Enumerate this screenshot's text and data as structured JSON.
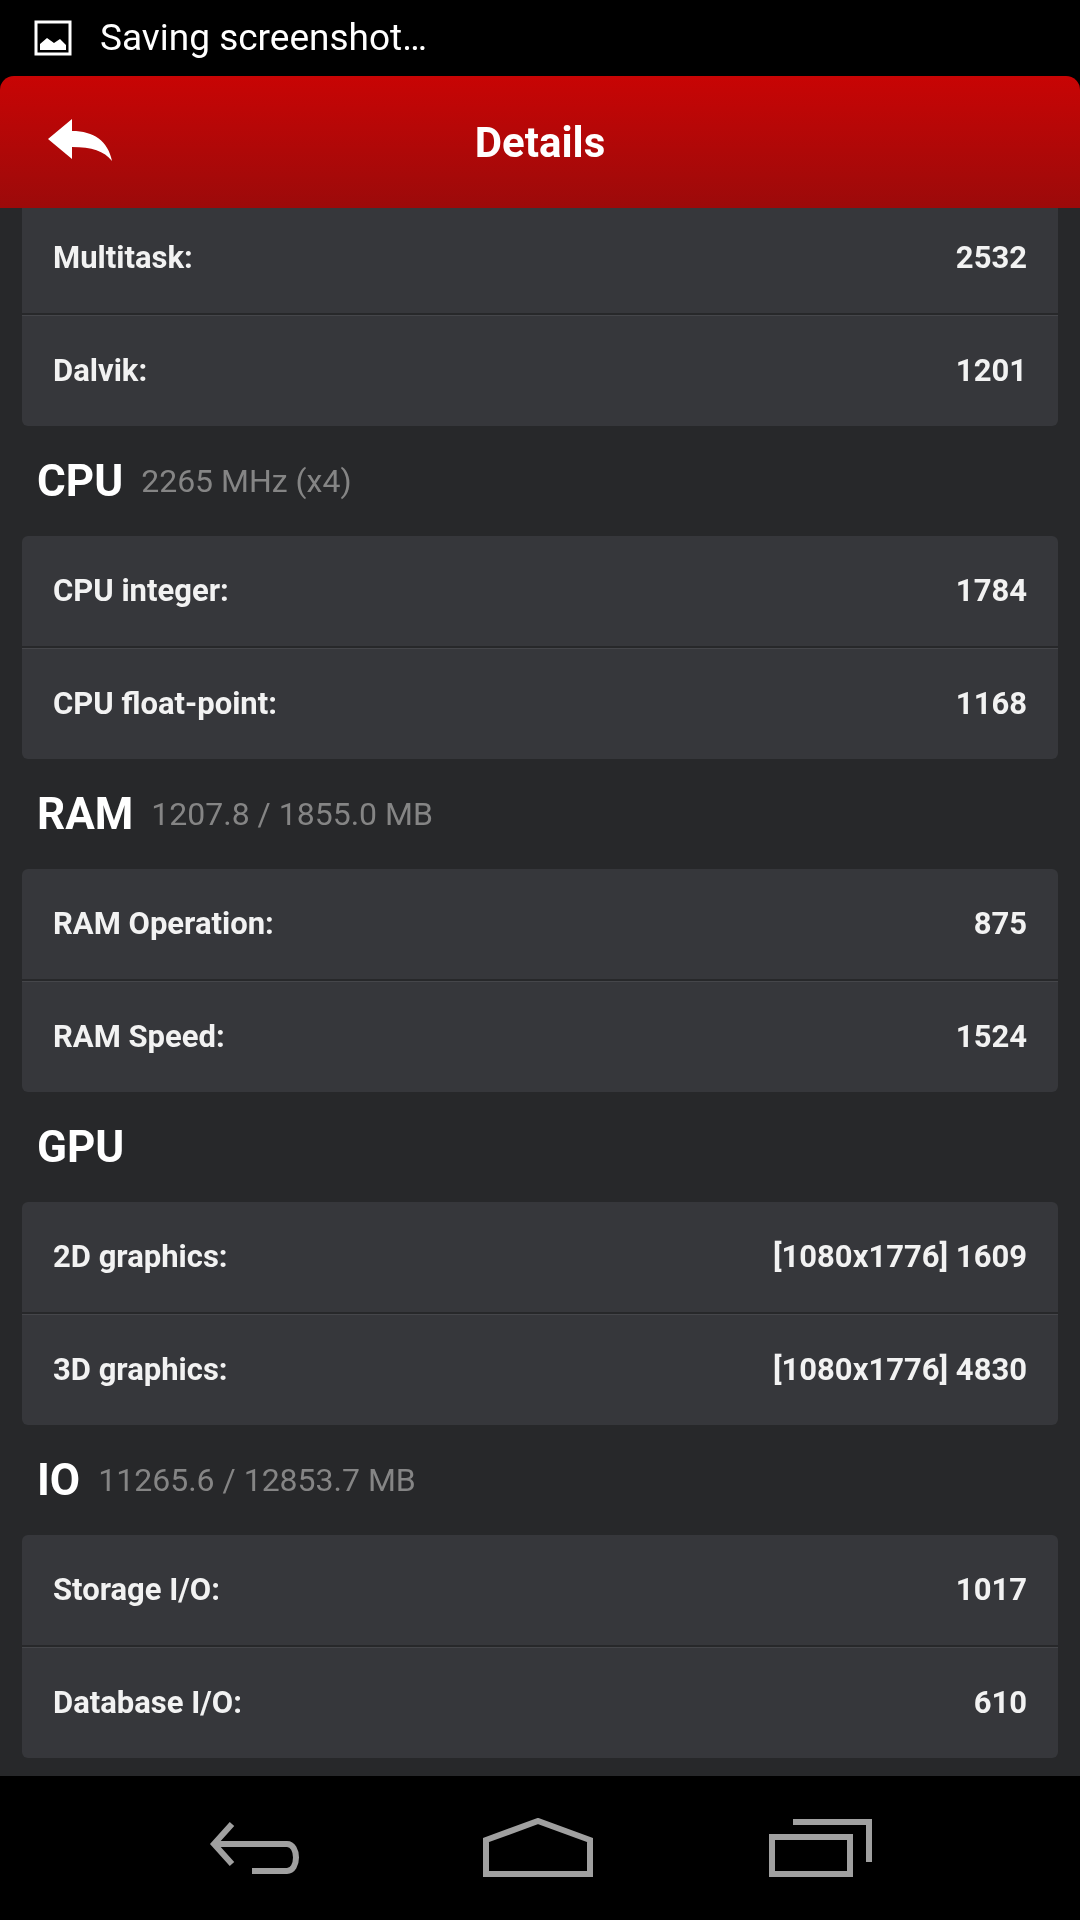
{
  "status_bar": {
    "notification": "Saving screenshot…"
  },
  "header": {
    "title": "Details"
  },
  "sections": [
    {
      "rows": [
        {
          "label": "Multitask:",
          "value": "2532"
        },
        {
          "label": "Dalvik:",
          "value": "1201"
        }
      ]
    },
    {
      "title": "CPU",
      "subtitle": "2265 MHz (x4)",
      "rows": [
        {
          "label": "CPU integer:",
          "value": "1784"
        },
        {
          "label": "CPU float-point:",
          "value": "1168"
        }
      ]
    },
    {
      "title": "RAM",
      "subtitle": "1207.8 / 1855.0 MB",
      "rows": [
        {
          "label": "RAM Operation:",
          "value": "875"
        },
        {
          "label": "RAM Speed:",
          "value": "1524"
        }
      ]
    },
    {
      "title": "GPU",
      "rows": [
        {
          "label": "2D graphics:",
          "value": "[1080x1776] 1609"
        },
        {
          "label": "3D graphics:",
          "value": "[1080x1776] 4830"
        }
      ]
    },
    {
      "title": "IO",
      "subtitle": "11265.6 / 12853.7 MB",
      "rows": [
        {
          "label": "Storage I/O:",
          "value": "1017"
        },
        {
          "label": "Database I/O:",
          "value": "610"
        }
      ]
    }
  ]
}
